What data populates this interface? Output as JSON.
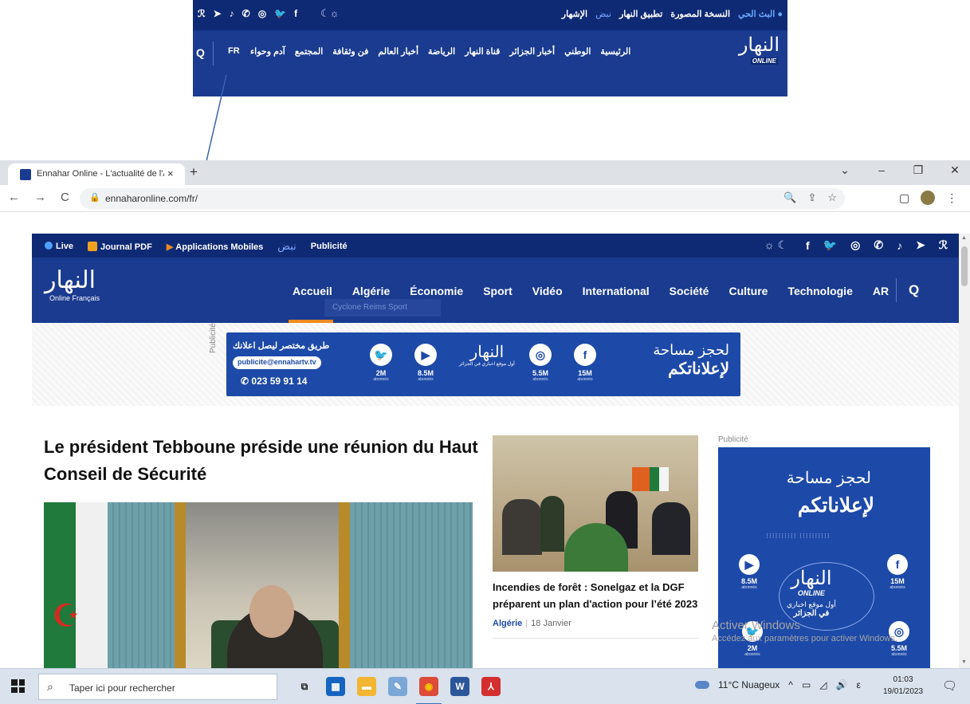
{
  "colors": {
    "navy_top": "#0f2a74",
    "navy_menu": "#1a3b8f",
    "banner_blue": "#1d4aa8",
    "accent_orange": "#f08a20",
    "arrow": "#3b63b0"
  },
  "inset": {
    "social_icons": [
      "rss-icon",
      "telegram-icon",
      "tiktok-icon",
      "whatsapp-icon",
      "instagram-icon",
      "twitter-icon",
      "facebook-icon"
    ],
    "social_glyphs": [
      "ℛ",
      "➤",
      "♪",
      "✆",
      "◎",
      "🐦",
      "f"
    ],
    "theme_glyph": "☾☼",
    "top_links": [
      "● البث الحي",
      "النسخة المصورة",
      "تطبيق النهار",
      "نبض",
      "الإشهار"
    ],
    "menu": [
      "الرئيسية",
      "الوطني",
      "أخبار الجزائر",
      "قناة النهار",
      "الرياضة",
      "أخبار العالم",
      "فن وثقافة",
      "المجتمع",
      "آدم وحواء"
    ],
    "lang": "FR",
    "search_glyph": "Q",
    "logo": "النهار",
    "logo_sub": "ONLINE"
  },
  "browser": {
    "tab_title": "Ennahar Online - L'actualité de l'Algérie",
    "tab_close": "×",
    "new_tab": "+",
    "window_controls": [
      "⌄",
      "–",
      "❐",
      "✕"
    ],
    "nav": [
      "←",
      "→",
      "C"
    ],
    "lock_glyph": "🔒",
    "url": "ennaharonline.com/fr/",
    "omni_actions": [
      "🔍",
      "⇪",
      "☆"
    ],
    "ext_glyphs": [
      "▢",
      "⋮"
    ]
  },
  "site": {
    "top_left": {
      "live": "Live",
      "journal": "Journal PDF",
      "apps": "Applications Mobiles",
      "nabd": "نبض",
      "pub": "Publicité"
    },
    "theme_glyph": "☼ ☾",
    "social_glyphs": [
      "f",
      "🐦",
      "◎",
      "✆",
      "♪",
      "➤",
      "ℛ"
    ],
    "social_icons": [
      "facebook-icon",
      "twitter-icon",
      "instagram-icon",
      "whatsapp-icon",
      "tiktok-icon",
      "telegram-icon",
      "rss-icon"
    ],
    "logo": "النهار",
    "logo_sub": "Online Français",
    "menu": [
      "Accueil",
      "Algérie",
      "Économie",
      "Sport",
      "Vidéo",
      "International",
      "Société",
      "Culture",
      "Technologie",
      "AR"
    ],
    "search_glyph": "Q",
    "tooltip": "Cyclone Reims Sport"
  },
  "ad_banner": {
    "side_label": "Publicité",
    "subtitle": "طريق مختصر ليصل اعلانك",
    "email": "publicite@ennahartv.tv",
    "phone": "023 59 91 14",
    "stats": [
      {
        "icon": "twitter-icon",
        "glyph": "🐦",
        "value": "2M",
        "sub": "abonnés"
      },
      {
        "icon": "youtube-icon",
        "glyph": "▶",
        "value": "8.5M",
        "sub": "abonnés"
      },
      {
        "icon": "instagram-icon",
        "glyph": "◎",
        "value": "5.5M",
        "sub": "abonnés"
      },
      {
        "icon": "facebook-icon",
        "glyph": "f",
        "value": "15M",
        "sub": "abonnés"
      }
    ],
    "logo": "النهار",
    "logo_tagline": "أول موقع اخباري في الجزائر",
    "big_line1": "لحجز مساحة",
    "big_line2": "لإعلاناتكم"
  },
  "main": {
    "hero_title": "Le président Tebboune préside une réunion du Haut Conseil de Sécurité",
    "side_title": "Incendies de forêt : Sonelgaz et la DGF préparent un plan d'action pour l’été 2023",
    "side_category": "Algérie",
    "side_date": "18 Janvier"
  },
  "side_ad": {
    "label": "Publicité",
    "line1": "لحجز مساحة",
    "line2": "لإعلاناتكم",
    "dots": "⁝⁝⁝⁝⁝⁝⁝⁝⁝⁝ ⁝⁝⁝⁝⁝⁝⁝⁝⁝⁝",
    "stats": [
      {
        "icon": "youtube-icon",
        "glyph": "▶",
        "value": "8.5M",
        "sub": "abonnés"
      },
      {
        "icon": "facebook-icon",
        "glyph": "f",
        "value": "15M",
        "sub": "abonnés"
      },
      {
        "icon": "twitter-icon",
        "glyph": "🐦",
        "value": "2M",
        "sub": "abonnés"
      },
      {
        "icon": "instagram-icon",
        "glyph": "◎",
        "value": "5.5M",
        "sub": "abonnés"
      }
    ],
    "logo": "النهار",
    "logo_sub": "ONLINE",
    "tag1": "أول موقع اخباري",
    "tag2": "في الجزائر"
  },
  "watermark": {
    "line1": "Activer Windows",
    "line2": "Accédez aux paramètres pour activer Windows."
  },
  "taskbar": {
    "search_glyph": "⌕",
    "search_placeholder": "Taper ici pour rechercher",
    "apps": [
      {
        "name": "task-view-app",
        "glyph": "⧉",
        "color": "#d9e2ed",
        "fg": "#222"
      },
      {
        "name": "store-app",
        "glyph": "▦",
        "color": "#1565c0",
        "fg": "#fff"
      },
      {
        "name": "file-explorer-app",
        "glyph": "▬",
        "color": "#f2b632",
        "fg": "#fff"
      },
      {
        "name": "paint-app",
        "glyph": "✎",
        "color": "#7aa7d6",
        "fg": "#fff"
      },
      {
        "name": "chrome-app",
        "glyph": "◉",
        "color": "#dd4b39",
        "fg": "#f6c700"
      },
      {
        "name": "word-app",
        "glyph": "W",
        "color": "#2b579a",
        "fg": "#fff"
      },
      {
        "name": "acrobat-app",
        "glyph": "⅄",
        "color": "#d32f2f",
        "fg": "#fff"
      }
    ],
    "weather": "11°C Nuageux",
    "tray_glyphs": [
      "^",
      "▭",
      "◿",
      "🔊",
      "ε"
    ],
    "time": "01:03",
    "date": "19/01/2023",
    "notif_glyph": "🗨"
  }
}
